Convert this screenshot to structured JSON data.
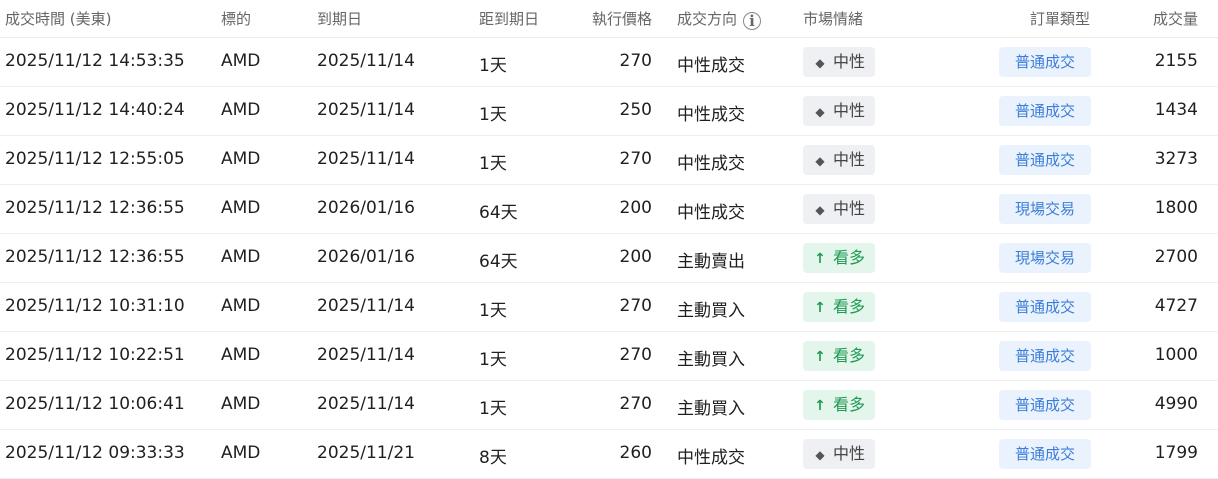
{
  "headers": {
    "time": "成交時間 (美東)",
    "symbol": "標的",
    "expiry": "到期日",
    "dte": "距到期日",
    "strike": "執行價格",
    "direction": "成交方向",
    "sentiment": "市場情緒",
    "order_type": "訂單類型",
    "volume": "成交量"
  },
  "icons": {
    "direction_info": "info-icon",
    "neutral": "diamond-icon",
    "bullish": "arrow-up-icon"
  },
  "colors": {
    "neutral_bg": "#eef0f3",
    "bullish_bg": "#e4f6ec",
    "bullish_text": "#1e9a53",
    "order_bg": "#eaf2fd",
    "order_text": "#3b7dd8"
  },
  "rows": [
    {
      "time": "2025/11/12 14:53:35",
      "symbol": "AMD",
      "expiry": "2025/11/14",
      "dte": "1天",
      "strike": "270",
      "direction": "中性成交",
      "sentiment": "中性",
      "order_type": "普通成交",
      "volume": "2155"
    },
    {
      "time": "2025/11/12 14:40:24",
      "symbol": "AMD",
      "expiry": "2025/11/14",
      "dte": "1天",
      "strike": "250",
      "direction": "中性成交",
      "sentiment": "中性",
      "order_type": "普通成交",
      "volume": "1434"
    },
    {
      "time": "2025/11/12 12:55:05",
      "symbol": "AMD",
      "expiry": "2025/11/14",
      "dte": "1天",
      "strike": "270",
      "direction": "中性成交",
      "sentiment": "中性",
      "order_type": "普通成交",
      "volume": "3273"
    },
    {
      "time": "2025/11/12 12:36:55",
      "symbol": "AMD",
      "expiry": "2026/01/16",
      "dte": "64天",
      "strike": "200",
      "direction": "中性成交",
      "sentiment": "中性",
      "order_type": "現場交易",
      "volume": "1800"
    },
    {
      "time": "2025/11/12 12:36:55",
      "symbol": "AMD",
      "expiry": "2026/01/16",
      "dte": "64天",
      "strike": "200",
      "direction": "主動賣出",
      "sentiment": "看多",
      "order_type": "現場交易",
      "volume": "2700"
    },
    {
      "time": "2025/11/12 10:31:10",
      "symbol": "AMD",
      "expiry": "2025/11/14",
      "dte": "1天",
      "strike": "270",
      "direction": "主動買入",
      "sentiment": "看多",
      "order_type": "普通成交",
      "volume": "4727"
    },
    {
      "time": "2025/11/12 10:22:51",
      "symbol": "AMD",
      "expiry": "2025/11/14",
      "dte": "1天",
      "strike": "270",
      "direction": "主動買入",
      "sentiment": "看多",
      "order_type": "普通成交",
      "volume": "1000"
    },
    {
      "time": "2025/11/12 10:06:41",
      "symbol": "AMD",
      "expiry": "2025/11/14",
      "dte": "1天",
      "strike": "270",
      "direction": "主動買入",
      "sentiment": "看多",
      "order_type": "普通成交",
      "volume": "4990"
    },
    {
      "time": "2025/11/12 09:33:33",
      "symbol": "AMD",
      "expiry": "2025/11/21",
      "dte": "8天",
      "strike": "260",
      "direction": "中性成交",
      "sentiment": "中性",
      "order_type": "普通成交",
      "volume": "1799"
    }
  ]
}
